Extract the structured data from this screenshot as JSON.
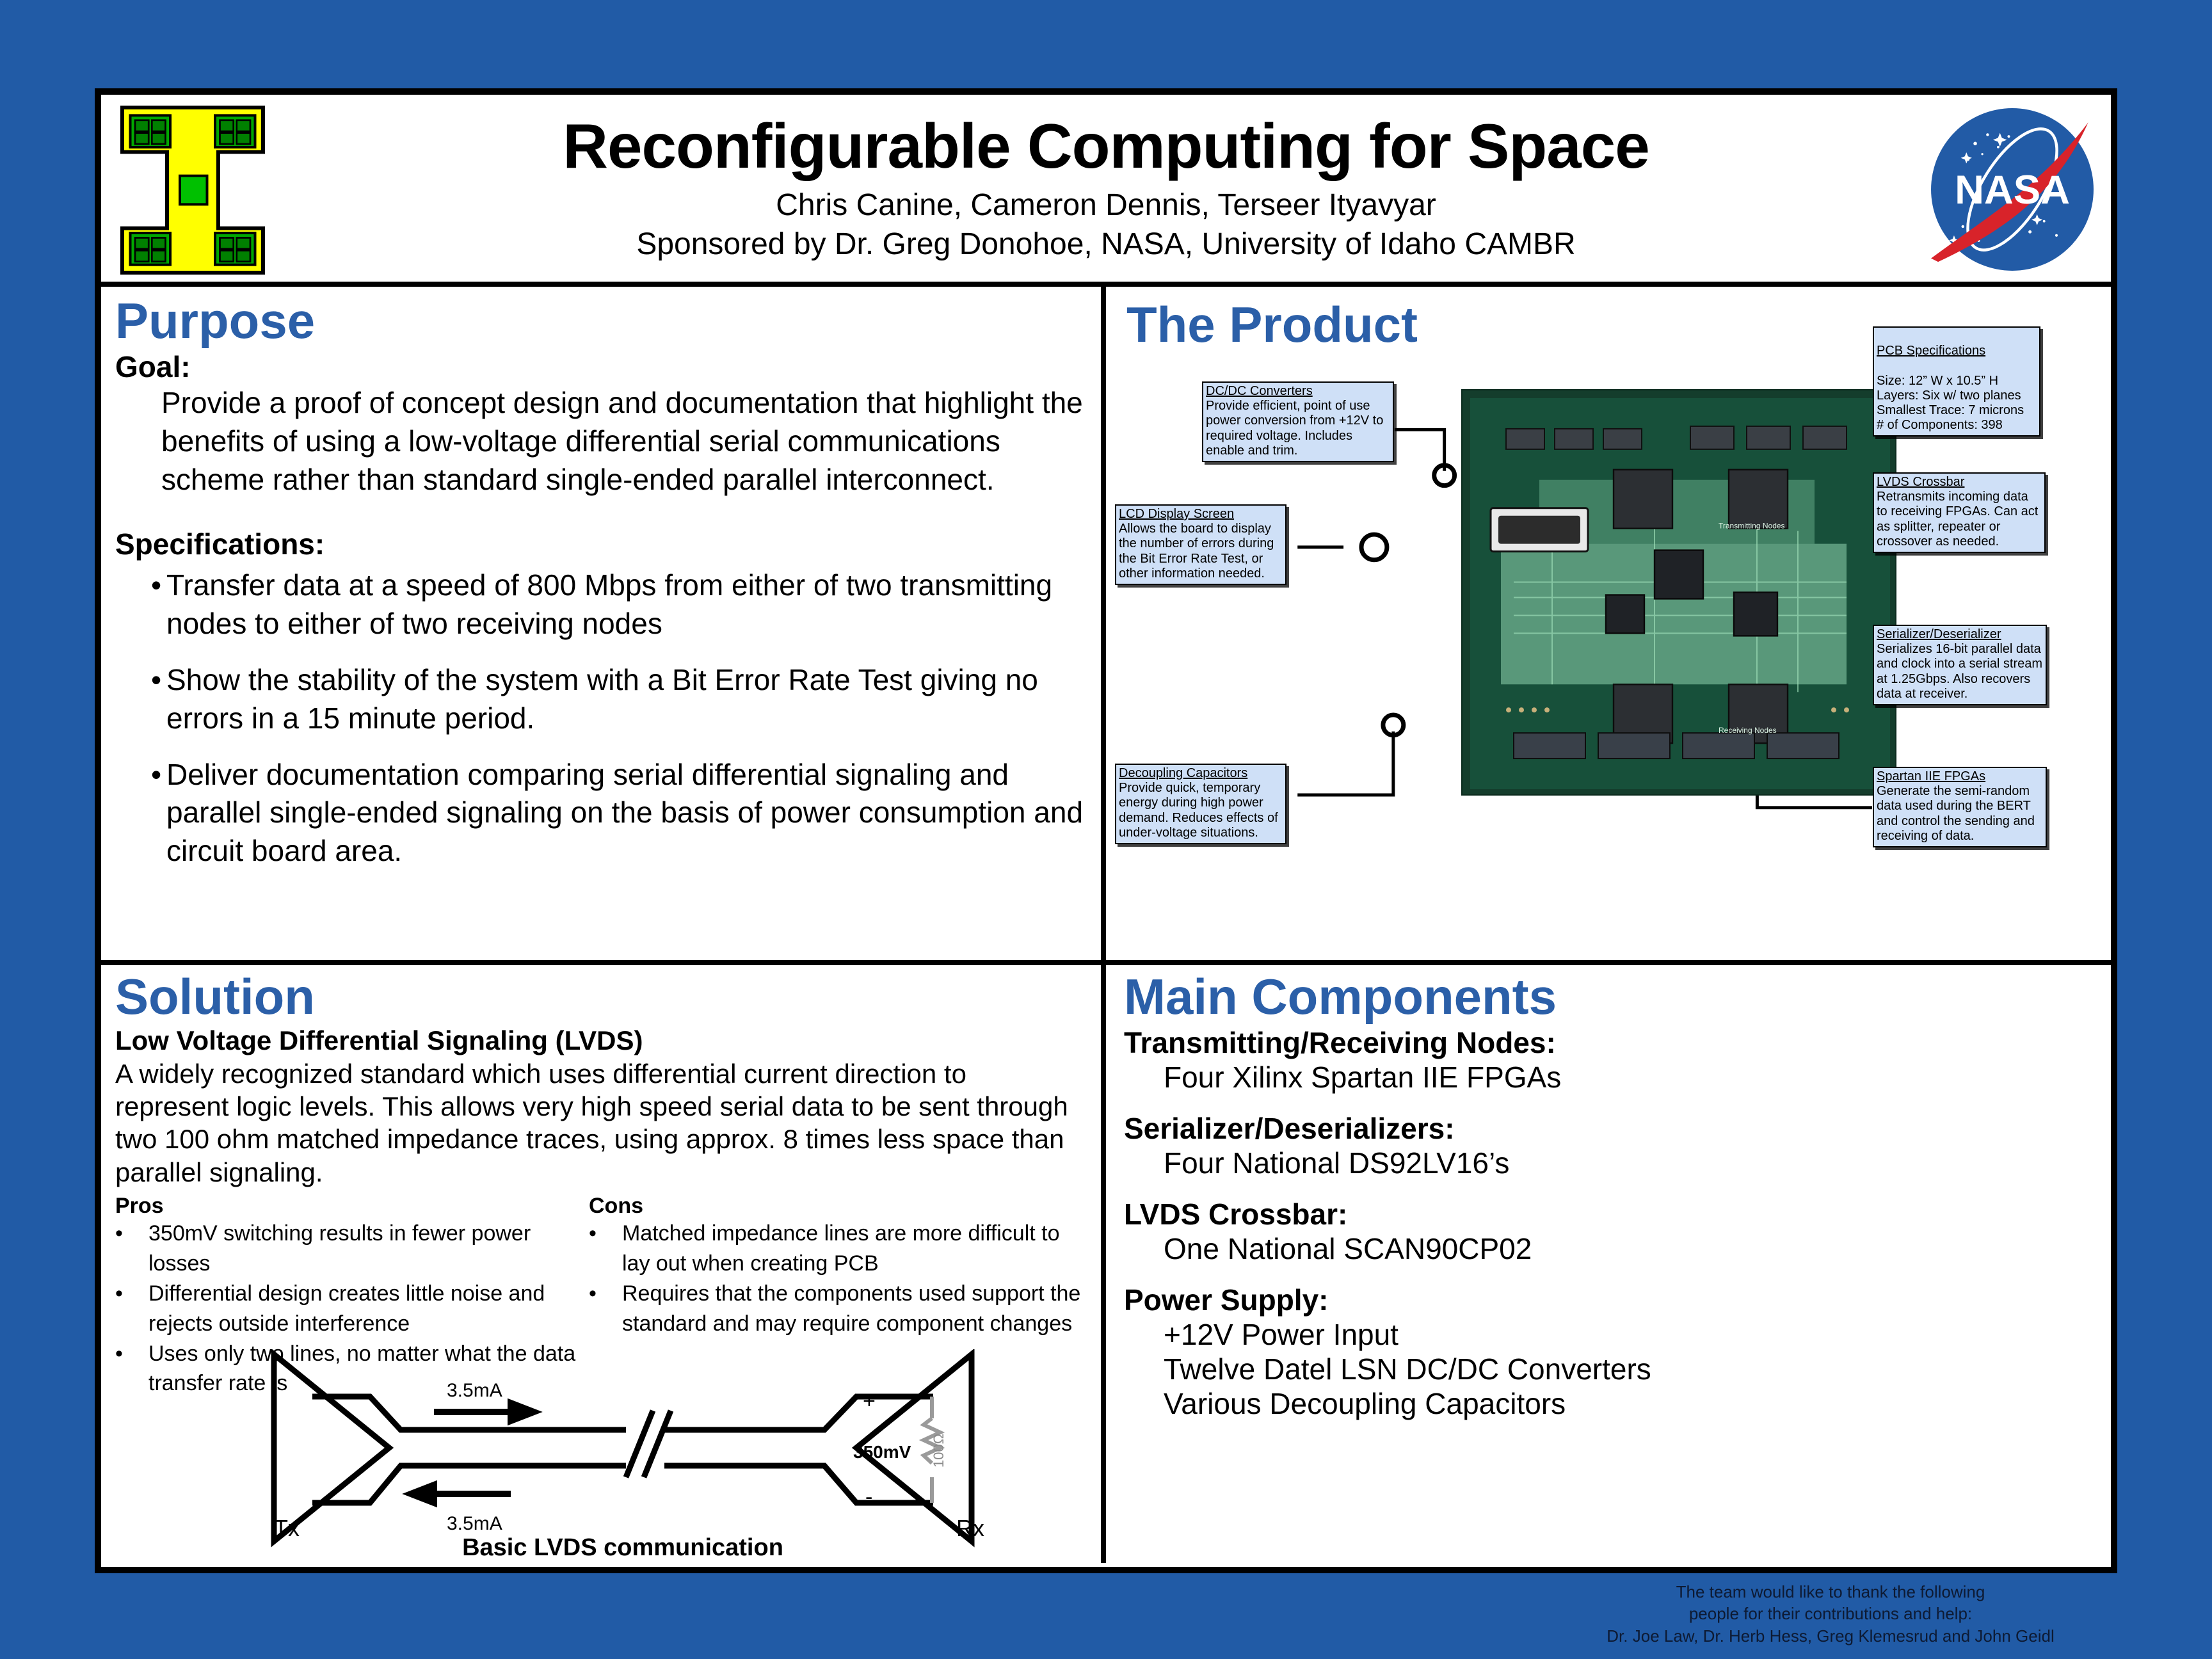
{
  "header": {
    "title": "Reconfigurable Computing for Space",
    "authors": "Chris Canine, Cameron Dennis, Terseer Ityavyar",
    "sponsors": "Sponsored by Dr. Greg Donohoe, NASA, University of Idaho CAMBR",
    "ui_logo_name": "university-of-idaho-chip-logo",
    "nasa_logo_text": "NASA"
  },
  "purpose": {
    "heading": "Purpose",
    "goal_label": "Goal:",
    "goal_text": "Provide a proof of concept design and documentation that highlight the benefits of using a low-voltage differential serial communications scheme rather than standard single-ended parallel interconnect.",
    "specs_label": "Specifications:",
    "specs": [
      "Transfer data at a speed of 800 Mbps from either of two transmitting nodes to either of two receiving nodes",
      "Show the stability of the system with a Bit Error Rate Test giving no errors in a 15 minute period.",
      "Deliver documentation comparing serial differential signaling and parallel single-ended signaling on the basis of power consumption and circuit board area."
    ],
    "bullet_char": "•"
  },
  "product": {
    "heading": "The Product",
    "photo_name": "pcb-photograph",
    "photo_labels": [
      "Transmitting Nodes",
      "Receiving Nodes"
    ],
    "callouts": [
      {
        "id": "dcdc",
        "title": "DC/DC Converters",
        "body": "Provide efficient, point of use power conversion from +12V to required voltage. Includes enable and trim."
      },
      {
        "id": "pcb-specs",
        "title": "PCB Specifications",
        "body": "Size: 12” W x 10.5” H\nLayers: Six w/ two planes\nSmallest Trace: 7 microns\n# of Components: 398"
      },
      {
        "id": "lvds-crossbar",
        "title": "LVDS Crossbar",
        "body": "Retransmits incoming data to receiving FPGAs.  Can act as splitter, repeater or crossover as needed."
      },
      {
        "id": "lcd-display",
        "title": "LCD Display Screen",
        "body": "Allows the board to display the number of errors during the Bit Error Rate Test, or other information needed."
      },
      {
        "id": "serdes",
        "title": "Serializer/Deserializer",
        "body": "Serializes 16-bit parallel data and clock into a serial stream at 1.25Gbps. Also recovers data at receiver."
      },
      {
        "id": "decoupling",
        "title": "Decoupling Capacitors",
        "body": "Provide quick, temporary energy during high power demand.  Reduces effects of under-voltage situations."
      },
      {
        "id": "spartan",
        "title": "Spartan IIE FPGAs",
        "body": "Generate the semi-random data used during the BERT and control the sending and receiving of data."
      }
    ]
  },
  "solution": {
    "heading": "Solution",
    "subtitle": "Low Voltage Differential Signaling (LVDS)",
    "intro": "A widely recognized standard which uses differential current direction to represent logic levels. This allows very high speed serial data to be sent through two 100 ohm matched impedance traces, using approx. 8 times less space than parallel signaling.",
    "pros_label": "Pros",
    "cons_label": "Cons",
    "pros": [
      "350mV switching results in fewer power losses",
      "Differential design creates little noise and rejects outside interference",
      "Uses only two lines, no matter what the data transfer rate is"
    ],
    "cons": [
      "Matched impedance lines are more difficult to lay out when creating PCB",
      "Requires that the components used support the standard and may require component changes"
    ],
    "bullet_char": "•",
    "diagram": {
      "caption": "Basic LVDS communication",
      "tx_label": "Tx",
      "rx_label": "Rx",
      "current_top": "3.5mA",
      "current_bottom": "3.5mA",
      "voltage": "350mV",
      "resistor": "100Ω",
      "plus": "+",
      "minus": "-"
    }
  },
  "components": {
    "heading": "Main Components",
    "items": [
      {
        "label": "Transmitting/Receiving Nodes:",
        "values": [
          "Four Xilinx Spartan IIE FPGAs"
        ]
      },
      {
        "label": "Serializer/Deserializers:",
        "values": [
          "Four National DS92LV16’s"
        ]
      },
      {
        "label": "LVDS Crossbar:",
        "values": [
          "One National SCAN90CP02"
        ]
      },
      {
        "label": "Power Supply:",
        "values": [
          "+12V Power Input",
          "Twelve Datel LSN DC/DC Converters",
          "Various Decoupling Capacitors"
        ]
      }
    ]
  },
  "footer": {
    "line1": "The team would like to thank the following",
    "line2": "people for their contributions and help:",
    "line3": "Dr. Joe Law, Dr. Herb Hess, Greg Klemesrud and John Geidl"
  },
  "colors": {
    "background_blue": "#215ba6",
    "heading_blue": "#2b5fa8",
    "callout_fill": "#cfe0f7",
    "logo_yellow": "#ffff00",
    "logo_green": "#00a000",
    "nasa_blue": "#225ba6",
    "nasa_red": "#d8232a",
    "pcb_green": "#11422f"
  }
}
